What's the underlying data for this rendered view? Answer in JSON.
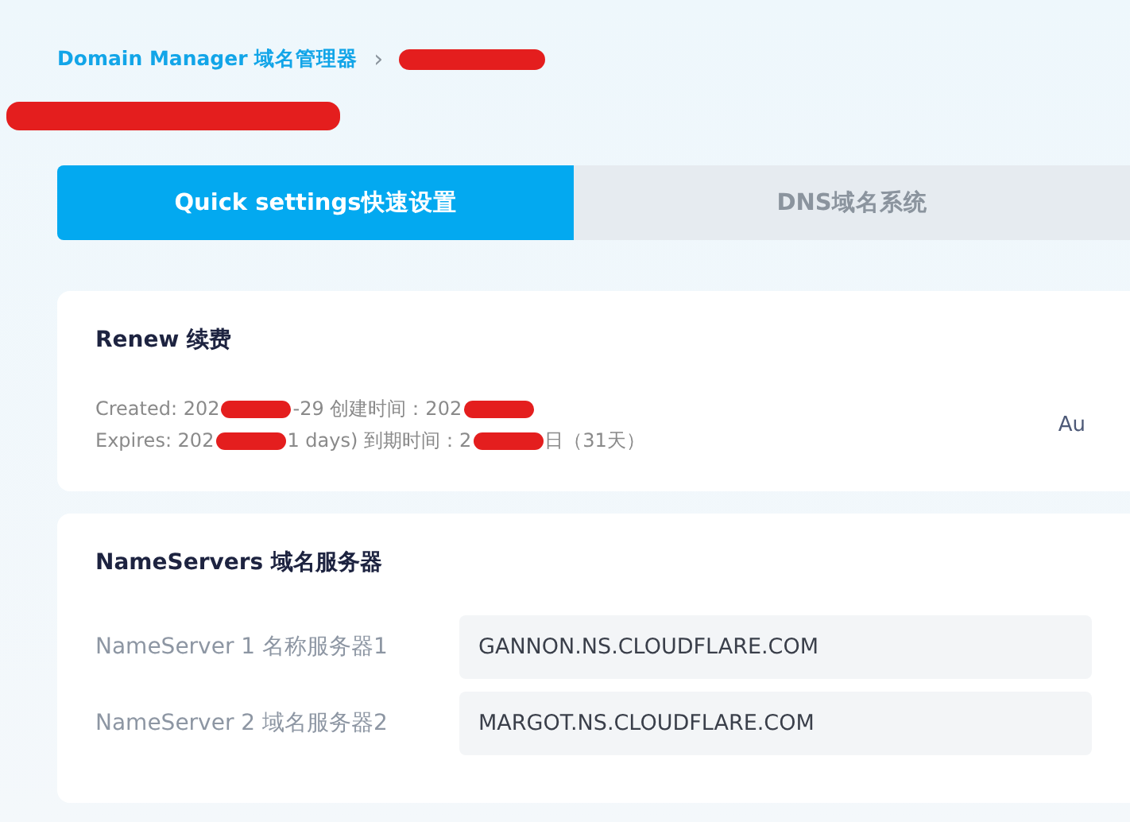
{
  "breadcrumb": {
    "root": "Domain Manager 域名管理器",
    "separator": "›",
    "current_redacted": true
  },
  "heading": {
    "redacted": true
  },
  "tabs": [
    {
      "label": "Quick settings快速设置",
      "selected": true
    },
    {
      "label": "DNS域名系统",
      "selected": false
    }
  ],
  "renew": {
    "title": "Renew 续费",
    "lines": [
      [
        {
          "kind": "text",
          "text": "Created: 202"
        },
        {
          "kind": "redaction"
        },
        {
          "kind": "text",
          "text": "-29 创建时间：202"
        },
        {
          "kind": "redaction"
        }
      ],
      [
        {
          "kind": "text",
          "text": "Expires: 202"
        },
        {
          "kind": "redaction"
        },
        {
          "kind": "text",
          "text": "1 days) 到期时间：2"
        },
        {
          "kind": "redaction"
        },
        {
          "kind": "text",
          "text": "日（31天）"
        }
      ]
    ],
    "right_text": "Au"
  },
  "nameservers": {
    "title": "NameServers 域名服务器",
    "rows": [
      {
        "label": "NameServer 1 名称服务器1",
        "value": "GANNON.NS.CLOUDFLARE.COM"
      },
      {
        "label": "NameServer 2 域名服务器2",
        "value": "MARGOT.NS.CLOUDFLARE.COM"
      }
    ]
  }
}
